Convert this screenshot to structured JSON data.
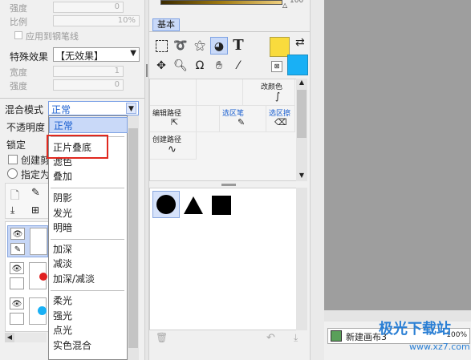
{
  "left_panel": {
    "strength_label": "强度",
    "strength_value": "0",
    "ratio_label": "比例",
    "ratio_value": "10%",
    "apply_pen_label": "应用到钢笔线",
    "special_effect_label": "特殊效果",
    "special_effect_value": "【无效果】",
    "width_label": "宽度",
    "width_value": "1",
    "strength2_label": "强度",
    "strength2_value": "0",
    "blend_mode_label": "混合模式",
    "blend_mode_value": "正常",
    "opacity_label": "不透明度",
    "lock_label": "锁定",
    "create_label": "创建剪",
    "specify_label": "指定为"
  },
  "blend_dropdown": {
    "items": [
      {
        "label": "正常"
      },
      {
        "label": "正片叠底"
      },
      {
        "label": "滤色"
      },
      {
        "label": "叠加"
      },
      {
        "label": "阴影"
      },
      {
        "label": "发光"
      },
      {
        "label": "明暗"
      },
      {
        "label": "加深"
      },
      {
        "label": "减淡"
      },
      {
        "label": "加深/减淡"
      },
      {
        "label": "柔光"
      },
      {
        "label": "强光"
      },
      {
        "label": "点光"
      },
      {
        "label": "实色混合"
      }
    ],
    "highlight_color": "#e0281f"
  },
  "tool_panel": {
    "tab_label": "基本",
    "gradient_value": "100",
    "fg_color": "#f9db3d",
    "bg_color": "#19b0f5",
    "icons": [
      "rect-select",
      "lasso",
      "magic-wand",
      "shape-fill",
      "text",
      "move",
      "zoom",
      "rotate",
      "hand",
      "eyedropper"
    ]
  },
  "brush_panel": {
    "cells": [
      {
        "label": "改颜色",
        "style": "normal"
      },
      {
        "label": "编辑路径",
        "style": "normal"
      },
      {
        "label": "选区笔",
        "style": "blue"
      },
      {
        "label": "选区擦",
        "style": "blue"
      },
      {
        "label": "创建路径",
        "style": "normal"
      }
    ]
  },
  "shapes_panel": {
    "shapes": [
      "circle",
      "triangle",
      "square"
    ]
  },
  "canvas": {
    "bg_color": "#9e9e9e"
  },
  "status_bar": {
    "doc_name": "新建画布3",
    "zoom": "100%"
  },
  "watermark": {
    "title": "极光下载站",
    "url": "www.xz7.com"
  },
  "layers": {
    "dot_colors": [
      "#e02020",
      "#19b0f5"
    ]
  }
}
